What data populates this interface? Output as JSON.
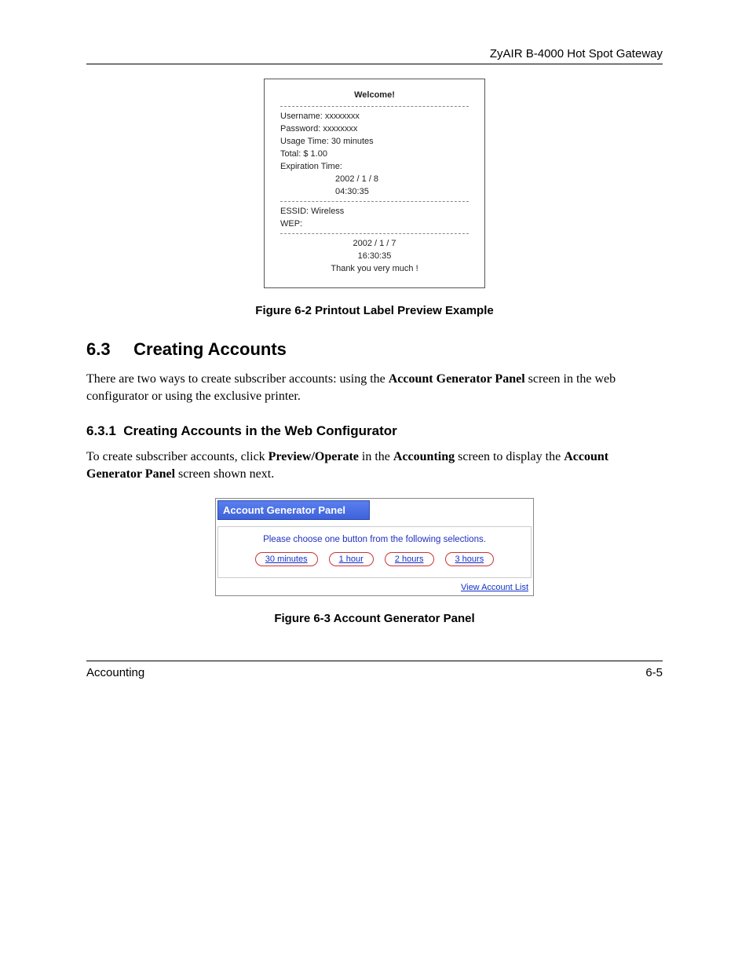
{
  "header": {
    "title": "ZyAIR B-4000 Hot Spot Gateway"
  },
  "printout": {
    "welcome": "Welcome!",
    "username_label": "Username:",
    "username_value": "xxxxxxxx",
    "password_label": "Password:",
    "password_value": "xxxxxxxx",
    "usage_label": "Usage Time:",
    "usage_value": "30 minutes",
    "total_label": "Total:",
    "total_value": "$  1.00",
    "exp_label": "Expiration Time:",
    "exp_date": "2002 / 1 / 8",
    "exp_time": "04:30:35",
    "essid_label": "ESSID:",
    "essid_value": "Wireless",
    "wep_label": "WEP:",
    "foot_date": "2002 / 1 / 7",
    "foot_time": "16:30:35",
    "thanks": "Thank you very much !"
  },
  "fig1_caption": "Figure 6-2 Printout Label Preview Example",
  "section": {
    "num": "6.3",
    "title": "Creating Accounts",
    "para_a": "There are two ways to create subscriber accounts: using the ",
    "para_b_bold": "Account Generator Panel",
    "para_c": " screen in the web configurator or using the exclusive printer."
  },
  "subsection": {
    "num": "6.3.1",
    "title": "Creating Accounts in the Web Configurator",
    "p_a": "To create subscriber accounts, click ",
    "p_b_bold": "Preview/Operate",
    "p_c": " in the ",
    "p_d_bold": "Accounting",
    "p_e": " screen to display the ",
    "p_f_bold": "Account Generator Panel",
    "p_g": " screen shown next."
  },
  "panel": {
    "title": "Account Generator Panel",
    "msg": "Please choose one button from the following selections.",
    "buttons": [
      "30 minutes",
      "1 hour",
      "2 hours",
      "3 hours"
    ],
    "view_link": "View Account List"
  },
  "fig2_caption": "Figure 6-3 Account Generator Panel",
  "footer": {
    "left": "Accounting",
    "right": "6-5"
  }
}
